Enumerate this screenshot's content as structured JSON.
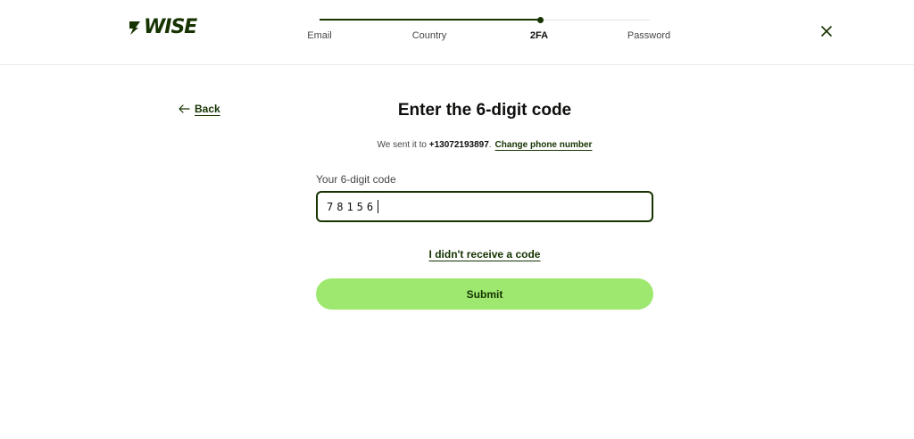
{
  "brand": {
    "name": "WISE",
    "logo_icon": "wise-flag-icon",
    "color": "#163300",
    "accent": "#9fe870"
  },
  "stepper": {
    "steps": [
      {
        "label": "Email",
        "state": "done"
      },
      {
        "label": "Country",
        "state": "done"
      },
      {
        "label": "2FA",
        "state": "current"
      },
      {
        "label": "Password",
        "state": "upcoming"
      }
    ],
    "progress_fraction": 0.667
  },
  "header": {
    "close_icon": "close-icon"
  },
  "nav": {
    "back_label": "Back",
    "back_icon": "arrow-left-icon"
  },
  "main": {
    "title": "Enter the 6-digit code",
    "sent_prefix": "We sent it to ",
    "phone": "+13072193897",
    "sent_suffix": ".",
    "change_phone_label": "Change phone number",
    "code_field_label": "Your 6-digit code",
    "code_value": "78156",
    "no_code_label": "I didn't receive a code",
    "submit_label": "Submit"
  }
}
